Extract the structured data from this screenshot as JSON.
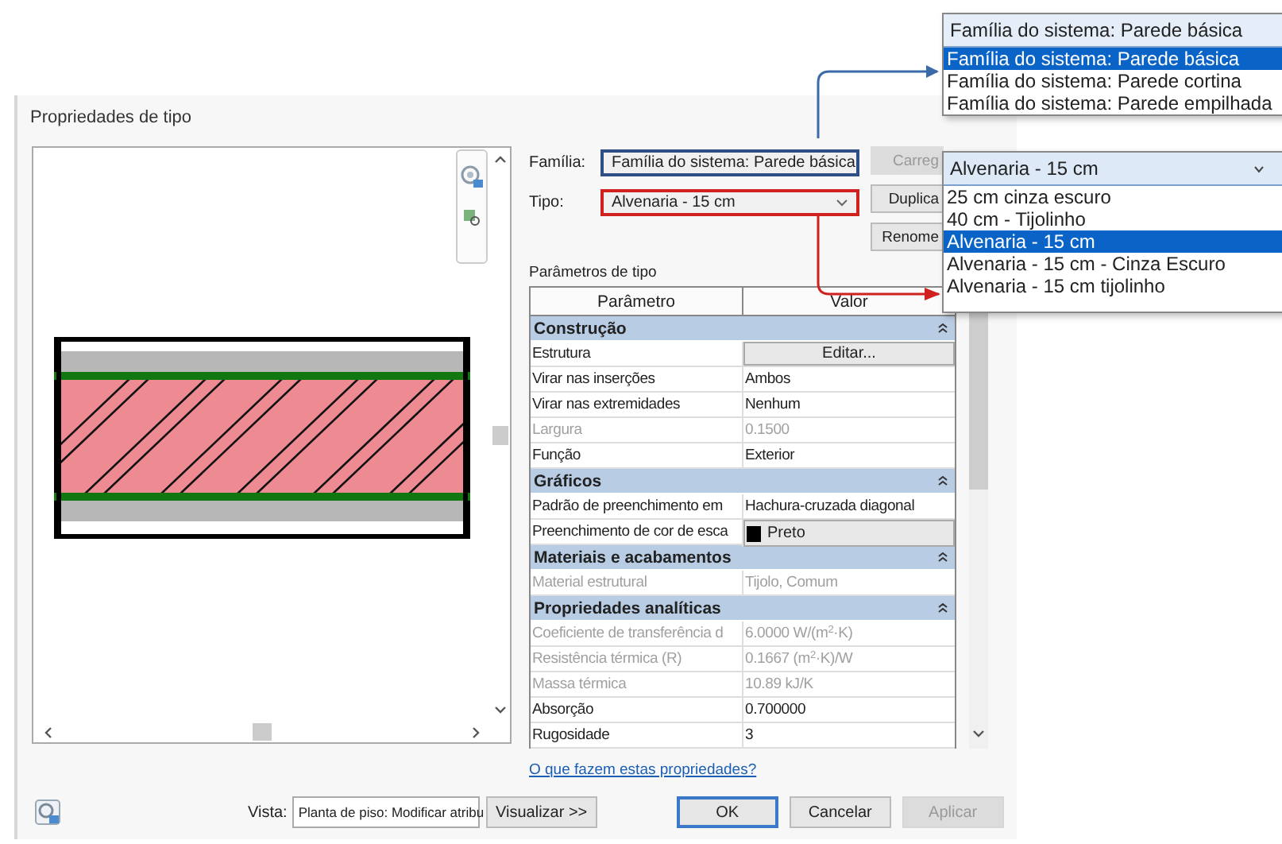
{
  "window": {
    "title": "Propriedades de tipo"
  },
  "family": {
    "label": "Família:",
    "value": "Família do sistema: Parede básica"
  },
  "type": {
    "label": "Tipo:",
    "value": "Alvenaria - 15 cm"
  },
  "side_buttons": [
    {
      "label": "Carreg",
      "disabled": true
    },
    {
      "label": "Duplica",
      "disabled": false
    },
    {
      "label": "Renome",
      "disabled": false
    }
  ],
  "params_title": "Parâmetros de tipo",
  "table": {
    "columns": [
      "Parâmetro",
      "Valor"
    ],
    "rows": [
      {
        "kind": "group",
        "name": "Construção",
        "expanded": true
      },
      {
        "kind": "button",
        "name": "Estrutura",
        "value": "Editar...",
        "disabled": false
      },
      {
        "kind": "text",
        "name": "Virar nas inserções",
        "value": "Ambos",
        "disabled": false
      },
      {
        "kind": "text",
        "name": "Virar nas extremidades",
        "value": "Nenhum",
        "disabled": false
      },
      {
        "kind": "text",
        "name": "Largura",
        "value": "0.1500",
        "disabled": true
      },
      {
        "kind": "text",
        "name": "Função",
        "value": "Exterior",
        "disabled": false
      },
      {
        "kind": "group",
        "name": "Gráficos",
        "expanded": true
      },
      {
        "kind": "text",
        "name": "Padrão de preenchimento em",
        "value": "Hachura-cruzada diagonal",
        "disabled": false
      },
      {
        "kind": "swatch",
        "name": "Preenchimento de cor de esca",
        "value": "Preto",
        "color": "#000000",
        "disabled": false
      },
      {
        "kind": "group",
        "name": "Materiais e acabamentos",
        "expanded": true
      },
      {
        "kind": "text",
        "name": "Material estrutural",
        "value": "Tijolo, Comum",
        "disabled": true
      },
      {
        "kind": "group",
        "name": "Propriedades analíticas",
        "expanded": true
      },
      {
        "kind": "text",
        "name": "Coeficiente de transferência d",
        "value": "6.0000 W/(m$^{2}$·K)",
        "disabled": true
      },
      {
        "kind": "text",
        "name": "Resistência térmica (R)",
        "value": "0.1667 (m$^{2}$·K)/W",
        "disabled": true
      },
      {
        "kind": "text",
        "name": "Massa térmica",
        "value": "10.89 kJ/K",
        "disabled": true
      },
      {
        "kind": "text",
        "name": "Absorção",
        "value": "0.700000",
        "disabled": false
      },
      {
        "kind": "text",
        "name": "Rugosidade",
        "value": "3",
        "disabled": false
      }
    ]
  },
  "help_link": "O que fazem estas propriedades?",
  "footer": {
    "view_label": "Vista:",
    "view_value": "Planta de piso: Modificar atribu",
    "buttons": [
      {
        "label": "Visualizar >>",
        "default": false,
        "disabled": false
      },
      {
        "label": "OK",
        "default": true,
        "disabled": false
      },
      {
        "label": "Cancelar",
        "default": false,
        "disabled": false
      },
      {
        "label": "Aplicar",
        "default": false,
        "disabled": true
      }
    ]
  },
  "family_dropdown": {
    "value": "Família do sistema: Parede básica",
    "options": [
      {
        "label": "Família do sistema: Parede básica",
        "selected": true
      },
      {
        "label": "Família do sistema: Parede cortina",
        "selected": false
      },
      {
        "label": "Família do sistema: Parede empilhada",
        "selected": false
      }
    ]
  },
  "type_dropdown": {
    "value": "Alvenaria - 15 cm",
    "options": [
      {
        "label": "25 cm cinza escuro",
        "selected": false
      },
      {
        "label": "40 cm - Tijolinho",
        "selected": false
      },
      {
        "label": "Alvenaria - 15 cm",
        "selected": true
      },
      {
        "label": "Alvenaria - 15 cm - Cinza Escuro",
        "selected": false
      },
      {
        "label": "Alvenaria - 15 cm tijolinho",
        "selected": false
      }
    ]
  }
}
